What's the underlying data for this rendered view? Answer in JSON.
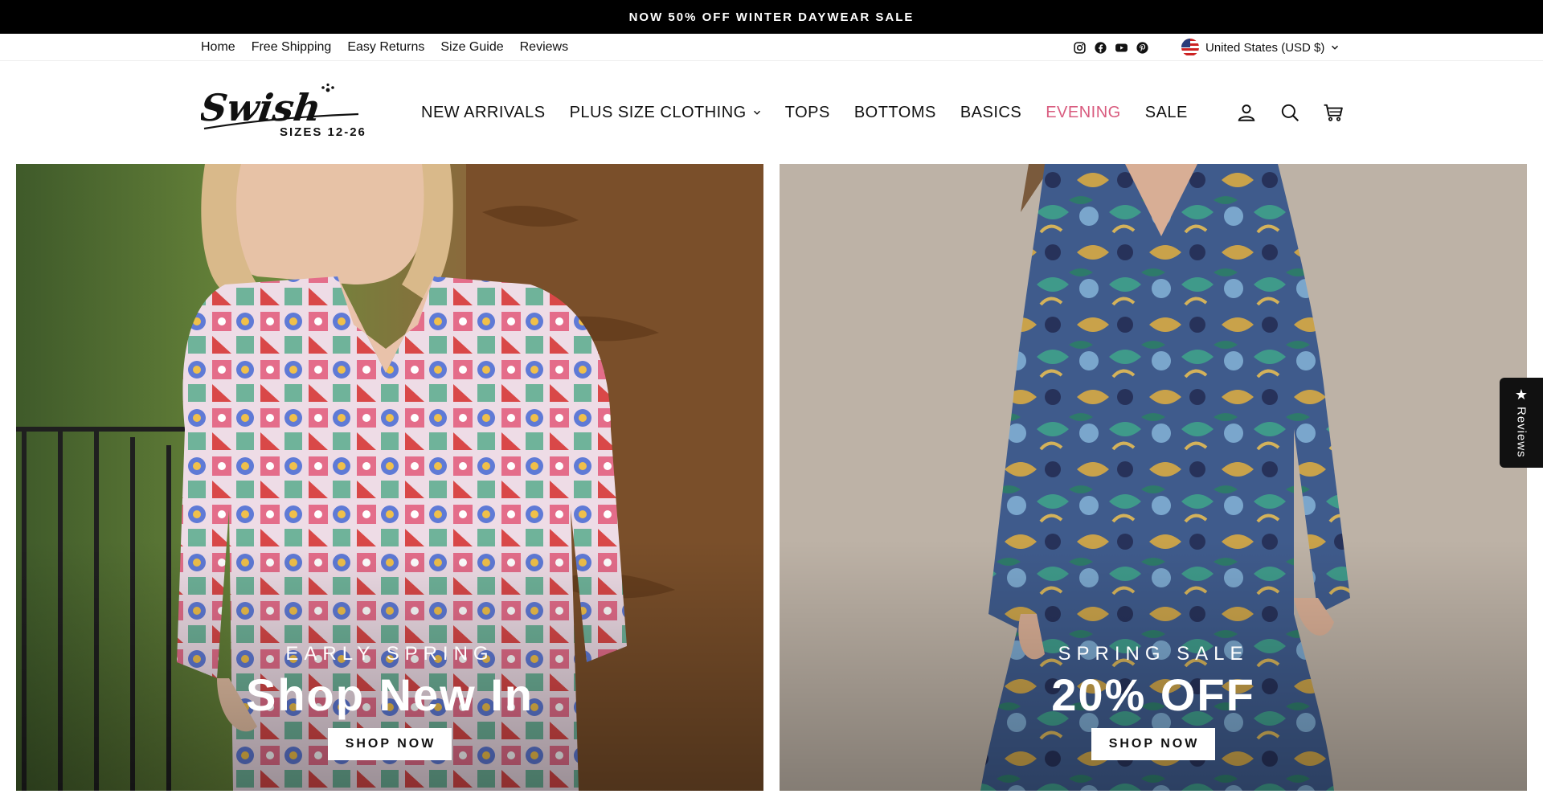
{
  "announcement": {
    "text": "NOW 50% OFF WINTER DAYWEAR SALE"
  },
  "utility": {
    "links": [
      "Home",
      "Free Shipping",
      "Easy Returns",
      "Size Guide",
      "Reviews"
    ],
    "social_icons": [
      "instagram-icon",
      "facebook-icon",
      "youtube-icon",
      "pinterest-icon"
    ],
    "country": "United States (USD $)"
  },
  "header": {
    "logo": {
      "wordmark": "Swish",
      "tagline": "SIZES 12-26"
    },
    "nav": [
      {
        "label": "NEW ARRIVALS"
      },
      {
        "label": "PLUS SIZE CLOTHING",
        "has_dropdown": true
      },
      {
        "label": "TOPS"
      },
      {
        "label": "BOTTOMS"
      },
      {
        "label": "BASICS"
      },
      {
        "label": "EVENING",
        "color": "#d95c7f"
      },
      {
        "label": "SALE"
      }
    ],
    "icons": [
      "account-icon",
      "search-icon",
      "cart-icon"
    ]
  },
  "hero": {
    "left": {
      "eyebrow": "EARLY SPRING",
      "title": "Shop New In",
      "button": "SHOP NOW"
    },
    "right": {
      "eyebrow": "SPRING SALE",
      "title": "20% OFF",
      "button": "SHOP NOW"
    }
  },
  "reviews_tab": {
    "label": "Reviews",
    "icon": "star-icon"
  },
  "colors": {
    "announcement_bg": "#000000",
    "evening_accent": "#d95c7f",
    "button_bg": "#ffffff"
  }
}
